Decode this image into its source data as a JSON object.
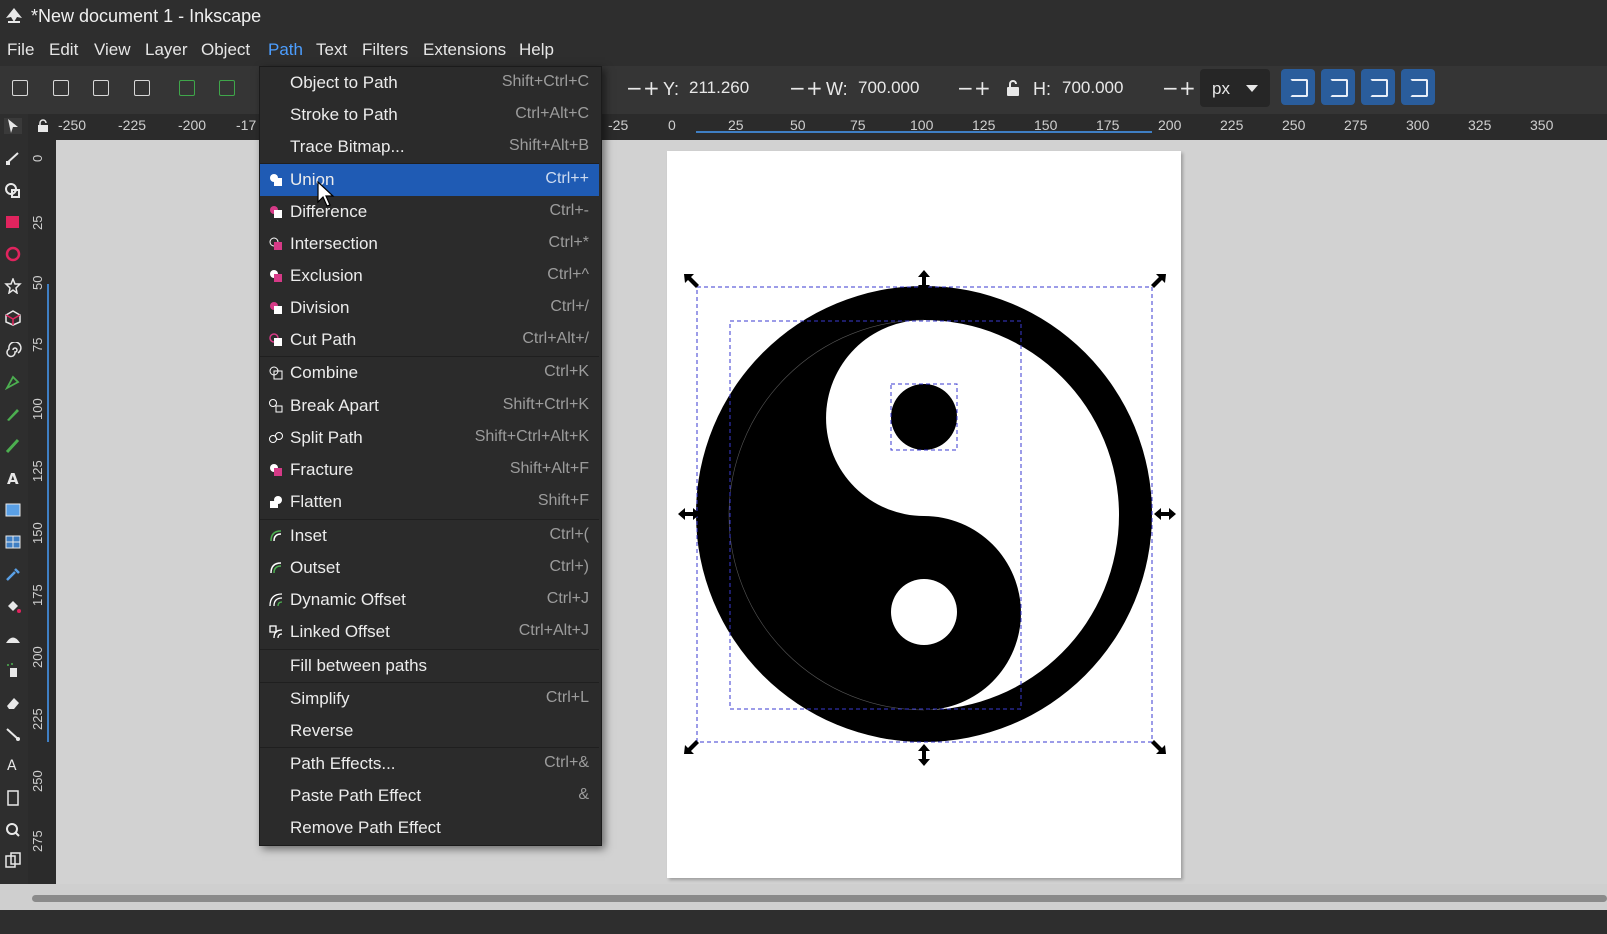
{
  "window": {
    "title": "*New document 1 - Inkscape"
  },
  "menubar": {
    "items": [
      "File",
      "Edit",
      "View",
      "Layer",
      "Object",
      "Path",
      "Text",
      "Filters",
      "Extensions",
      "Help"
    ],
    "active": "Path"
  },
  "toolbar": {
    "y_label": "Y:",
    "y_value": "211.260",
    "w_label": "W:",
    "w_value": "700.000",
    "h_label": "H:",
    "h_value": "700.000",
    "unit": "px",
    "minus": "−",
    "plus": "+"
  },
  "ruler_h": {
    "labels": [
      "-250",
      "-225",
      "-200",
      "-17",
      "-25",
      "0",
      "25",
      "50",
      "75",
      "100",
      "125",
      "150",
      "175",
      "200",
      "225",
      "250",
      "275",
      "300",
      "325",
      "350"
    ]
  },
  "ruler_v": {
    "labels": [
      "0",
      "25",
      "50",
      "75",
      "100",
      "125",
      "150",
      "175",
      "200",
      "225",
      "250",
      "275"
    ]
  },
  "path_menu": {
    "items": [
      {
        "label": "Object to Path",
        "shortcut": "Shift+Ctrl+C",
        "icon": ""
      },
      {
        "label": "Stroke to Path",
        "shortcut": "Ctrl+Alt+C",
        "icon": ""
      },
      {
        "label": "Trace Bitmap...",
        "shortcut": "Shift+Alt+B",
        "icon": ""
      },
      {
        "label": "Union",
        "shortcut": "Ctrl++",
        "icon": "union-icon",
        "highlighted": true
      },
      {
        "label": "Difference",
        "shortcut": "Ctrl+-",
        "icon": "difference-icon"
      },
      {
        "label": "Intersection",
        "shortcut": "Ctrl+*",
        "icon": "intersection-icon"
      },
      {
        "label": "Exclusion",
        "shortcut": "Ctrl+^",
        "icon": "exclusion-icon"
      },
      {
        "label": "Division",
        "shortcut": "Ctrl+/",
        "icon": "division-icon"
      },
      {
        "label": "Cut Path",
        "shortcut": "Ctrl+Alt+/",
        "icon": "cut-path-icon"
      },
      {
        "label": "Combine",
        "shortcut": "Ctrl+K",
        "icon": "combine-icon"
      },
      {
        "label": "Break Apart",
        "shortcut": "Shift+Ctrl+K",
        "icon": "break-apart-icon"
      },
      {
        "label": "Split Path",
        "shortcut": "Shift+Ctrl+Alt+K",
        "icon": "split-path-icon"
      },
      {
        "label": "Fracture",
        "shortcut": "Shift+Alt+F",
        "icon": "fracture-icon"
      },
      {
        "label": "Flatten",
        "shortcut": "Shift+F",
        "icon": "flatten-icon"
      },
      {
        "label": "Inset",
        "shortcut": "Ctrl+(",
        "icon": "inset-icon"
      },
      {
        "label": "Outset",
        "shortcut": "Ctrl+)",
        "icon": "outset-icon"
      },
      {
        "label": "Dynamic Offset",
        "shortcut": "Ctrl+J",
        "icon": "dynamic-offset-icon"
      },
      {
        "label": "Linked Offset",
        "shortcut": "Ctrl+Alt+J",
        "icon": "linked-offset-icon"
      },
      {
        "label": "Fill between paths",
        "shortcut": "",
        "icon": ""
      },
      {
        "label": "Simplify",
        "shortcut": "Ctrl+L",
        "icon": ""
      },
      {
        "label": "Reverse",
        "shortcut": "",
        "icon": ""
      },
      {
        "label": "Path Effects...",
        "shortcut": "Ctrl+&",
        "icon": ""
      },
      {
        "label": "Paste Path Effect",
        "shortcut": "&",
        "icon": ""
      },
      {
        "label": "Remove Path Effect",
        "shortcut": "",
        "icon": ""
      }
    ]
  },
  "colors": {
    "accent": "#1f5bb4",
    "active_menu": "#4c9eff",
    "menu_bg": "#2b2b2b",
    "icon_pink": "#d63a87",
    "icon_green": "#4caf50"
  }
}
